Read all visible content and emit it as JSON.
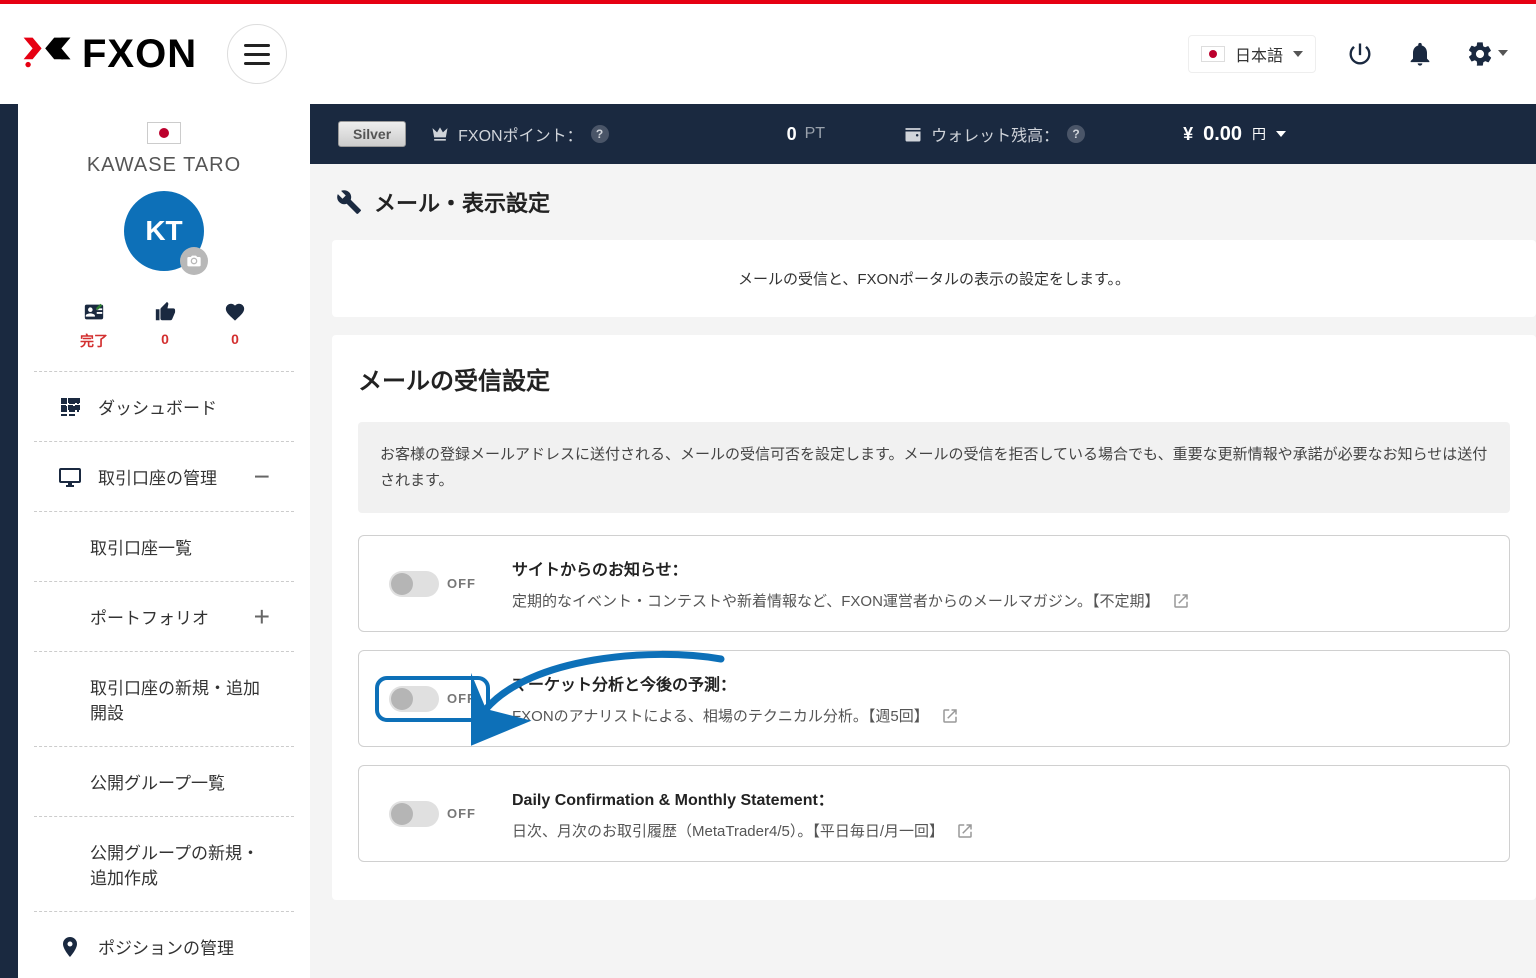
{
  "header": {
    "logo_text": "FXON",
    "language": "日本語"
  },
  "profile": {
    "name": "KAWASE TARO",
    "initials": "KT",
    "stats": {
      "status": "完了",
      "likes": "0",
      "favorites": "0"
    }
  },
  "sidebar": {
    "dashboard": "ダッシュボード",
    "accounts": "取引口座の管理",
    "accounts_list": "取引口座一覧",
    "portfolio": "ポートフォリオ",
    "accounts_new": "取引口座の新規・追加開設",
    "groups_list": "公開グループ一覧",
    "groups_new": "公開グループの新規・追加作成",
    "positions": "ポジションの管理"
  },
  "topbar": {
    "tier": "Silver",
    "points_label": "FXONポイント：",
    "points_value": "0",
    "points_unit": "PT",
    "wallet_label": "ウォレット残高：",
    "balance_symbol": "¥",
    "balance_value": "0.00",
    "balance_unit": "円"
  },
  "page": {
    "title": "メール・表示設定",
    "intro": "メールの受信と、FXONポータルの表示の設定をします。。",
    "section_title": "メールの受信設定",
    "note": "お客様の登録メールアドレスに送付される、メールの受信可否を設定します。メールの受信を拒否している場合でも、重要な更新情報や承諾が必要なお知らせは送付されます。",
    "off": "OFF",
    "settings": {
      "site_news": {
        "title": "サイトからのお知らせ：",
        "desc": "定期的なイベント・コンテストや新着情報など、FXON運営者からのメールマガジン。【不定期】"
      },
      "market": {
        "title": "マーケット分析と今後の予測：",
        "desc": "FXONのアナリストによる、相場のテクニカル分析。【週5回】"
      },
      "daily": {
        "title": "Daily Confirmation & Monthly Statement：",
        "desc": "日次、月次のお取引履歴（MetaTrader4/5）。【平日毎日/月一回】"
      }
    }
  }
}
